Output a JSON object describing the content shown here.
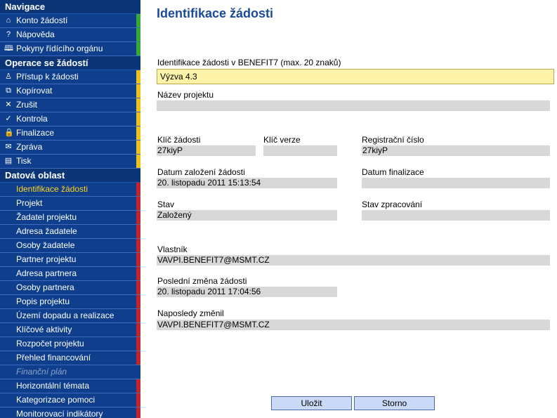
{
  "sidebar": {
    "navigation": {
      "title": "Navigace",
      "items": [
        {
          "label": "Konto žádostí",
          "icon": "⌂"
        },
        {
          "label": "Nápověda",
          "icon": "?"
        },
        {
          "label": "Pokyny řídícího orgánu",
          "icon": "🕮"
        }
      ]
    },
    "operations": {
      "title": "Operace se žádostí",
      "items": [
        {
          "label": "Přístup k žádosti",
          "icon": "♙"
        },
        {
          "label": "Kopírovat",
          "icon": "⧉"
        },
        {
          "label": "Zrušit",
          "icon": "✕"
        },
        {
          "label": "Kontrola",
          "icon": "✓"
        },
        {
          "label": "Finalizace",
          "icon": "🔒"
        },
        {
          "label": "Zpráva",
          "icon": "✉"
        },
        {
          "label": "Tisk",
          "icon": "▤"
        }
      ]
    },
    "data_area": {
      "title": "Datová oblast",
      "items": [
        {
          "label": "Identifikace žádosti"
        },
        {
          "label": "Projekt"
        },
        {
          "label": "Žadatel projektu"
        },
        {
          "label": "Adresa žadatele"
        },
        {
          "label": "Osoby žadatele"
        },
        {
          "label": "Partner projektu"
        },
        {
          "label": "Adresa partnera"
        },
        {
          "label": "Osoby partnera"
        },
        {
          "label": "Popis projektu"
        },
        {
          "label": "Území dopadu a realizace"
        },
        {
          "label": "Klíčové aktivity"
        },
        {
          "label": "Rozpočet projektu"
        },
        {
          "label": "Přehled financování"
        },
        {
          "label": "Finanční plán"
        },
        {
          "label": "Horizontální témata"
        },
        {
          "label": "Kategorizace pomoci"
        },
        {
          "label": "Monitorovací indikátory"
        }
      ]
    }
  },
  "main": {
    "title": "Identifikace žádosti",
    "fields": {
      "identification": {
        "label": "Identifikace žádosti v BENEFIT7 (max. 20 znaků)",
        "value": "Výzva 4.3"
      },
      "project_name": {
        "label": "Název projektu",
        "value": ""
      },
      "request_key": {
        "label": "Klíč žádosti",
        "value": "27kiyP"
      },
      "version_key": {
        "label": "Klíč verze",
        "value": ""
      },
      "registration_number": {
        "label": "Registrační číslo",
        "value": "27kiyP"
      },
      "created_date": {
        "label": "Datum založení žádosti",
        "value": "20. listopadu 2011 15:13:54"
      },
      "finalization_date": {
        "label": "Datum finalizace",
        "value": ""
      },
      "status": {
        "label": "Stav",
        "value": "Založený"
      },
      "processing_status": {
        "label": "Stav zpracování",
        "value": ""
      },
      "owner": {
        "label": "Vlastník",
        "value": "VAVPI.BENEFIT7@MSMT.CZ"
      },
      "last_change": {
        "label": "Poslední změna žádosti",
        "value": "20. listopadu 2011 17:04:56"
      },
      "last_changed_by": {
        "label": "Naposledy změnil",
        "value": "VAVPI.BENEFIT7@MSMT.CZ"
      }
    },
    "buttons": {
      "save": "Uložit",
      "cancel": "Storno"
    }
  },
  "colors": {
    "sidebar_bg": "#0f3f8c",
    "title": "#1a4b9c",
    "input_bg": "#fdf3a8",
    "readonly_bg": "#d8d8d8",
    "button_bg": "#c9d9f7"
  }
}
